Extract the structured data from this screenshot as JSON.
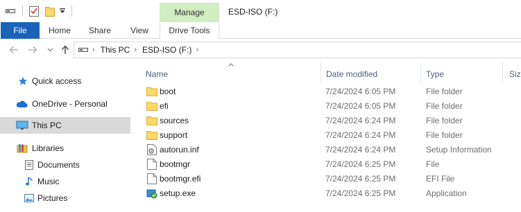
{
  "window": {
    "title": "ESD-ISO (F:)",
    "contextual_tab_group": "Manage"
  },
  "quick_access_toolbar": {
    "icons": [
      "drive-icon",
      "properties-icon",
      "new-folder-icon",
      "customize-dropdown-icon"
    ]
  },
  "ribbon": {
    "tabs": [
      {
        "label": "File",
        "active": true
      },
      {
        "label": "Home"
      },
      {
        "label": "Share"
      },
      {
        "label": "View"
      },
      {
        "label": "Drive Tools"
      }
    ],
    "accent_color": "#1a63b8",
    "manage_color": "#cfeec1"
  },
  "address": {
    "segments": [
      "This PC",
      "ESD-ISO (F:)"
    ]
  },
  "navigation_pane": {
    "items": [
      {
        "label": "Quick access",
        "icon": "star-icon"
      },
      {
        "label": "OneDrive - Personal",
        "icon": "cloud-icon"
      },
      {
        "label": "This PC",
        "icon": "monitor-icon",
        "selected": true
      },
      {
        "label": "Libraries",
        "icon": "libraries-icon"
      },
      {
        "label": "Documents",
        "icon": "documents-icon"
      },
      {
        "label": "Music",
        "icon": "music-icon"
      },
      {
        "label": "Pictures",
        "icon": "pictures-icon"
      }
    ]
  },
  "file_list": {
    "columns": [
      "Name",
      "Date modified",
      "Type",
      "Size"
    ],
    "rows": [
      {
        "name": "boot",
        "date": "7/24/2024 6:05 PM",
        "type": "File folder",
        "icon": "folder-icon"
      },
      {
        "name": "efi",
        "date": "7/24/2024 6:05 PM",
        "type": "File folder",
        "icon": "folder-icon"
      },
      {
        "name": "sources",
        "date": "7/24/2024 6:24 PM",
        "type": "File folder",
        "icon": "folder-icon"
      },
      {
        "name": "support",
        "date": "7/24/2024 6:24 PM",
        "type": "File folder",
        "icon": "folder-icon"
      },
      {
        "name": "autorun.inf",
        "date": "7/24/2024 6:24 PM",
        "type": "Setup Information",
        "icon": "setup-info-icon"
      },
      {
        "name": "bootmgr",
        "date": "7/24/2024 6:25 PM",
        "type": "File",
        "icon": "file-icon"
      },
      {
        "name": "bootmgr.efi",
        "date": "7/24/2024 6:25 PM",
        "type": "EFI File",
        "icon": "file-icon"
      },
      {
        "name": "setup.exe",
        "date": "7/24/2024 6:25 PM",
        "type": "Application",
        "icon": "setup-exe-icon"
      }
    ]
  }
}
